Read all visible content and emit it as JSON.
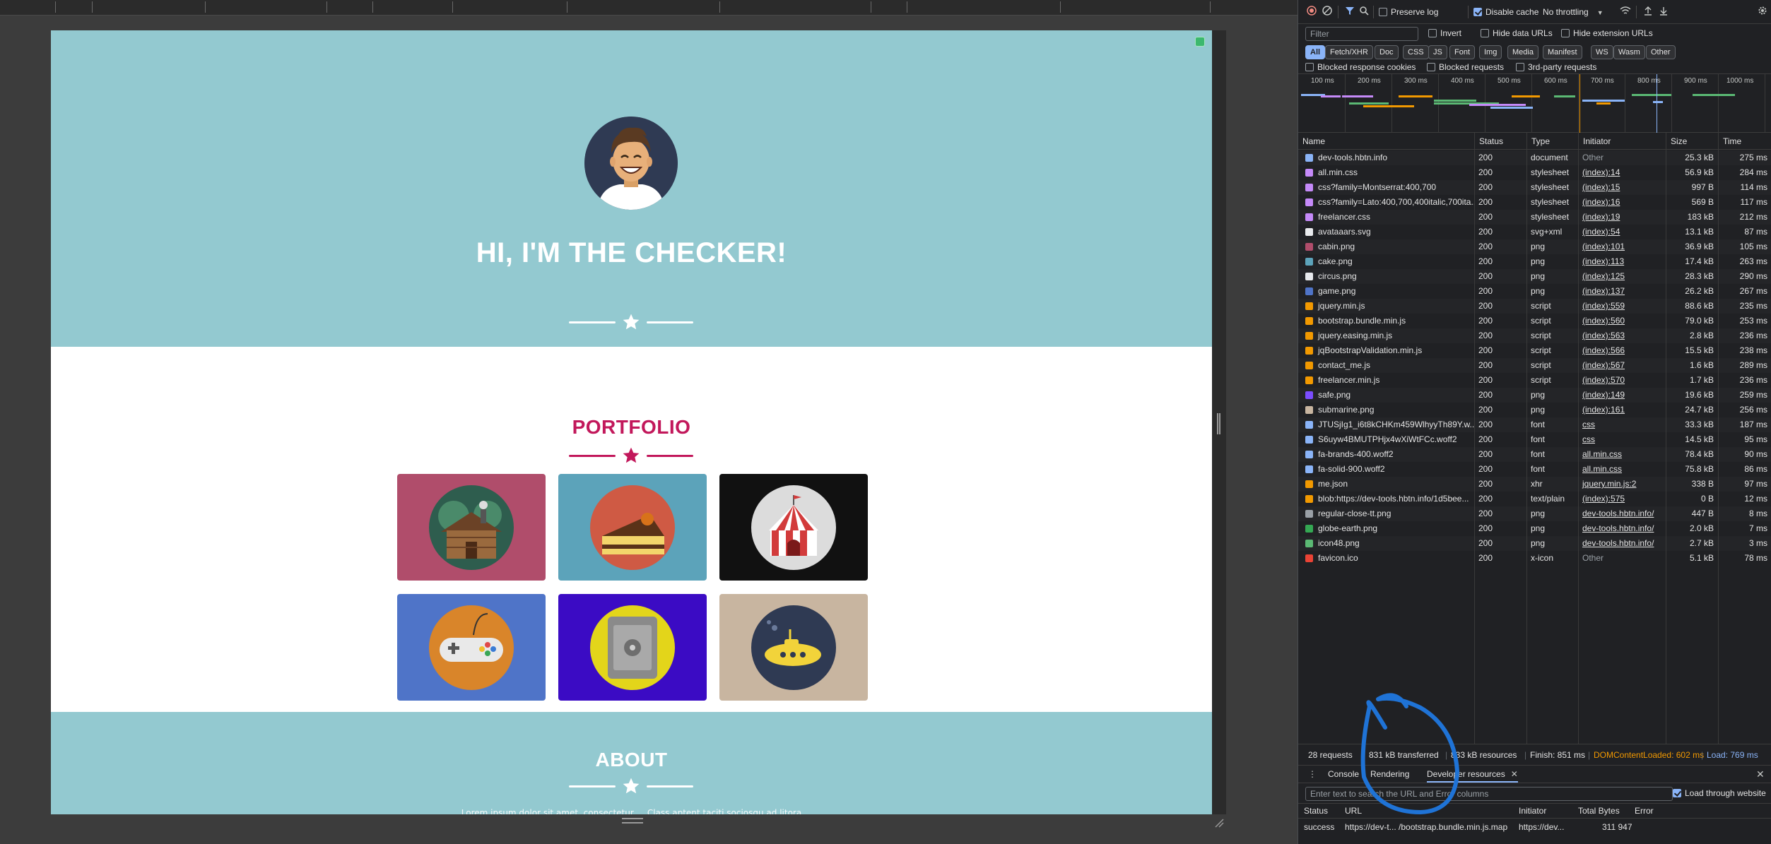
{
  "page": {
    "hero_title": "HI, I'M THE CHECKER!",
    "portfolio_title": "PORTFOLIO",
    "about_title": "ABOUT",
    "about_text": "Lorem ipsum dolor sit amet, consectetur ... Class aptent taciti sociosqu ad litora",
    "colors": {
      "masthead": "#93c9d0",
      "accent": "#c2185b"
    },
    "tiles": [
      {
        "name": "cabin",
        "bg": "#b04d6b"
      },
      {
        "name": "cake",
        "bg": "#5ca3ba"
      },
      {
        "name": "circus",
        "bg": "#111111"
      },
      {
        "name": "game",
        "bg": "#4f74c8"
      },
      {
        "name": "safe",
        "bg": "#3b0bc4"
      },
      {
        "name": "submarine",
        "bg": "#c8b5a0"
      }
    ]
  },
  "devtools": {
    "toolbar": {
      "preserve_log": "Preserve log",
      "disable_cache": "Disable cache",
      "throttling": "No throttling"
    },
    "filter": {
      "placeholder": "Filter",
      "invert": "Invert",
      "hide_data_urls": "Hide data URLs",
      "hide_extension_urls": "Hide extension URLs"
    },
    "types": [
      "All",
      "Fetch/XHR",
      "Doc",
      "CSS",
      "JS",
      "Font",
      "Img",
      "Media",
      "Manifest",
      "WS",
      "Wasm",
      "Other"
    ],
    "blocked": {
      "cookies": "Blocked response cookies",
      "requests": "Blocked requests",
      "third_party": "3rd-party requests"
    },
    "overview_ticks": [
      "100 ms",
      "200 ms",
      "300 ms",
      "400 ms",
      "500 ms",
      "600 ms",
      "700 ms",
      "800 ms",
      "900 ms",
      "1000 ms"
    ],
    "columns": [
      "Name",
      "Status",
      "Type",
      "Initiator",
      "Size",
      "Time"
    ],
    "rows": [
      {
        "name": "dev-tools.hbtn.info",
        "status": "200",
        "type": "document",
        "initiator": "Other",
        "size": "25.3 kB",
        "time": "275 ms",
        "icon": "#8ab4f8"
      },
      {
        "name": "all.min.css",
        "status": "200",
        "type": "stylesheet",
        "initiator": "(index):14",
        "size": "56.9 kB",
        "time": "284 ms",
        "icon": "#c58af9"
      },
      {
        "name": "css?family=Montserrat:400,700",
        "status": "200",
        "type": "stylesheet",
        "initiator": "(index):15",
        "size": "997 B",
        "time": "114 ms",
        "icon": "#c58af9"
      },
      {
        "name": "css?family=Lato:400,700,400italic,700ita...",
        "status": "200",
        "type": "stylesheet",
        "initiator": "(index):16",
        "size": "569 B",
        "time": "117 ms",
        "icon": "#c58af9"
      },
      {
        "name": "freelancer.css",
        "status": "200",
        "type": "stylesheet",
        "initiator": "(index):19",
        "size": "183 kB",
        "time": "212 ms",
        "icon": "#c58af9"
      },
      {
        "name": "avataaars.svg",
        "status": "200",
        "type": "svg+xml",
        "initiator": "(index):54",
        "size": "13.1 kB",
        "time": "87 ms",
        "icon": "#e8eaed"
      },
      {
        "name": "cabin.png",
        "status": "200",
        "type": "png",
        "initiator": "(index):101",
        "size": "36.9 kB",
        "time": "105 ms",
        "icon": "#b04d6b"
      },
      {
        "name": "cake.png",
        "status": "200",
        "type": "png",
        "initiator": "(index):113",
        "size": "17.4 kB",
        "time": "263 ms",
        "icon": "#5ca3ba"
      },
      {
        "name": "circus.png",
        "status": "200",
        "type": "png",
        "initiator": "(index):125",
        "size": "28.3 kB",
        "time": "290 ms",
        "icon": "#e8eaed"
      },
      {
        "name": "game.png",
        "status": "200",
        "type": "png",
        "initiator": "(index):137",
        "size": "26.2 kB",
        "time": "267 ms",
        "icon": "#4f74c8"
      },
      {
        "name": "jquery.min.js",
        "status": "200",
        "type": "script",
        "initiator": "(index):559",
        "size": "88.6 kB",
        "time": "235 ms",
        "icon": "#f29900"
      },
      {
        "name": "bootstrap.bundle.min.js",
        "status": "200",
        "type": "script",
        "initiator": "(index):560",
        "size": "79.0 kB",
        "time": "253 ms",
        "icon": "#f29900"
      },
      {
        "name": "jquery.easing.min.js",
        "status": "200",
        "type": "script",
        "initiator": "(index):563",
        "size": "2.8 kB",
        "time": "236 ms",
        "icon": "#f29900"
      },
      {
        "name": "jqBootstrapValidation.min.js",
        "status": "200",
        "type": "script",
        "initiator": "(index):566",
        "size": "15.5 kB",
        "time": "238 ms",
        "icon": "#f29900"
      },
      {
        "name": "contact_me.js",
        "status": "200",
        "type": "script",
        "initiator": "(index):567",
        "size": "1.6 kB",
        "time": "289 ms",
        "icon": "#f29900"
      },
      {
        "name": "freelancer.min.js",
        "status": "200",
        "type": "script",
        "initiator": "(index):570",
        "size": "1.7 kB",
        "time": "236 ms",
        "icon": "#f29900"
      },
      {
        "name": "safe.png",
        "status": "200",
        "type": "png",
        "initiator": "(index):149",
        "size": "19.6 kB",
        "time": "259 ms",
        "icon": "#7b4dff"
      },
      {
        "name": "submarine.png",
        "status": "200",
        "type": "png",
        "initiator": "(index):161",
        "size": "24.7 kB",
        "time": "256 ms",
        "icon": "#c8b5a0"
      },
      {
        "name": "JTUSjIg1_i6t8kCHKm459WlhyyTh89Y.w...",
        "status": "200",
        "type": "font",
        "initiator": "css",
        "size": "33.3 kB",
        "time": "187 ms",
        "icon": "#8ab4f8"
      },
      {
        "name": "S6uyw4BMUTPHjx4wXiWtFCc.woff2",
        "status": "200",
        "type": "font",
        "initiator": "css",
        "size": "14.5 kB",
        "time": "95 ms",
        "icon": "#8ab4f8"
      },
      {
        "name": "fa-brands-400.woff2",
        "status": "200",
        "type": "font",
        "initiator": "all.min.css",
        "size": "78.4 kB",
        "time": "90 ms",
        "icon": "#8ab4f8"
      },
      {
        "name": "fa-solid-900.woff2",
        "status": "200",
        "type": "font",
        "initiator": "all.min.css",
        "size": "75.8 kB",
        "time": "86 ms",
        "icon": "#8ab4f8"
      },
      {
        "name": "me.json",
        "status": "200",
        "type": "xhr",
        "initiator": "jquery.min.js:2",
        "size": "338 B",
        "time": "97 ms",
        "icon": "#f29900"
      },
      {
        "name": "blob:https://dev-tools.hbtn.info/1d5bee...",
        "status": "200",
        "type": "text/plain",
        "initiator": "(index):575",
        "size": "0 B",
        "time": "12 ms",
        "icon": "#f29900"
      },
      {
        "name": "regular-close-tt.png",
        "status": "200",
        "type": "png",
        "initiator": "dev-tools.hbtn.info/",
        "size": "447 B",
        "time": "8 ms",
        "icon": "#9aa0a6"
      },
      {
        "name": "globe-earth.png",
        "status": "200",
        "type": "png",
        "initiator": "dev-tools.hbtn.info/",
        "size": "2.0 kB",
        "time": "7 ms",
        "icon": "#34a853"
      },
      {
        "name": "icon48.png",
        "status": "200",
        "type": "png",
        "initiator": "dev-tools.hbtn.info/",
        "size": "2.7 kB",
        "time": "3 ms",
        "icon": "#5bb974"
      },
      {
        "name": "favicon.ico",
        "status": "200",
        "type": "x-icon",
        "initiator": "Other",
        "size": "5.1 kB",
        "time": "78 ms",
        "icon": "#ea4335"
      }
    ],
    "status_bar": {
      "requests": "28 requests",
      "transferred": "831 kB transferred",
      "resources": "833 kB resources",
      "finish": "Finish: 851 ms",
      "dom_content_loaded": "DOMContentLoaded: 602 ms",
      "load": "Load: 769 ms"
    },
    "drawer": {
      "tabs": [
        "Console",
        "Rendering",
        "Developer resources"
      ],
      "search_placeholder": "Enter text to search the URL and Error columns",
      "load_through_website": "Load through website",
      "columns": [
        "Status",
        "URL",
        "Initiator",
        "Total Bytes",
        "Error"
      ],
      "row": {
        "status": "success",
        "url": "https://dev-t... /bootstrap.bundle.min.js.map",
        "initiator": "https://dev...",
        "total_bytes": "311 947",
        "error": ""
      }
    }
  }
}
